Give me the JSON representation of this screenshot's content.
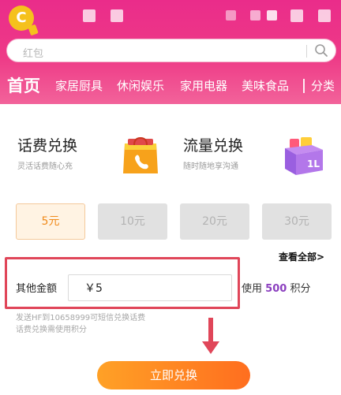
{
  "app": {
    "logo_glyph": "C"
  },
  "search": {
    "placeholder": "红包"
  },
  "nav": {
    "items": [
      "首页",
      "家居厨具",
      "休闲娱乐",
      "家用电器",
      "美味食品",
      "分类"
    ],
    "active_index": 0
  },
  "cards": [
    {
      "title": "话费兑换",
      "subtitle": "灵活话费随心充",
      "icon": "shopping-bag-phone-icon"
    },
    {
      "title": "流量兑换",
      "subtitle": "随时随地享沟通",
      "icon": "gift-box-icon"
    }
  ],
  "amounts": {
    "options": [
      "5元",
      "10元",
      "20元",
      "30元"
    ],
    "selected_index": 0,
    "view_all": "查看全部>"
  },
  "other_amount": {
    "label": "其他金额",
    "value": "￥5",
    "points_prefix": "使用",
    "points_value": "500",
    "points_suffix": "积分"
  },
  "sms_note": {
    "line1": "发送HF到10658999可短信兑换话费",
    "line2": "话费兑换需使用积分"
  },
  "redeem_button": "立即兑换",
  "colors": {
    "header": "#ea2c8a",
    "accent_orange": "#ff8a1f",
    "points_purple": "#8b3fbf",
    "annotation_red": "#e04659"
  }
}
